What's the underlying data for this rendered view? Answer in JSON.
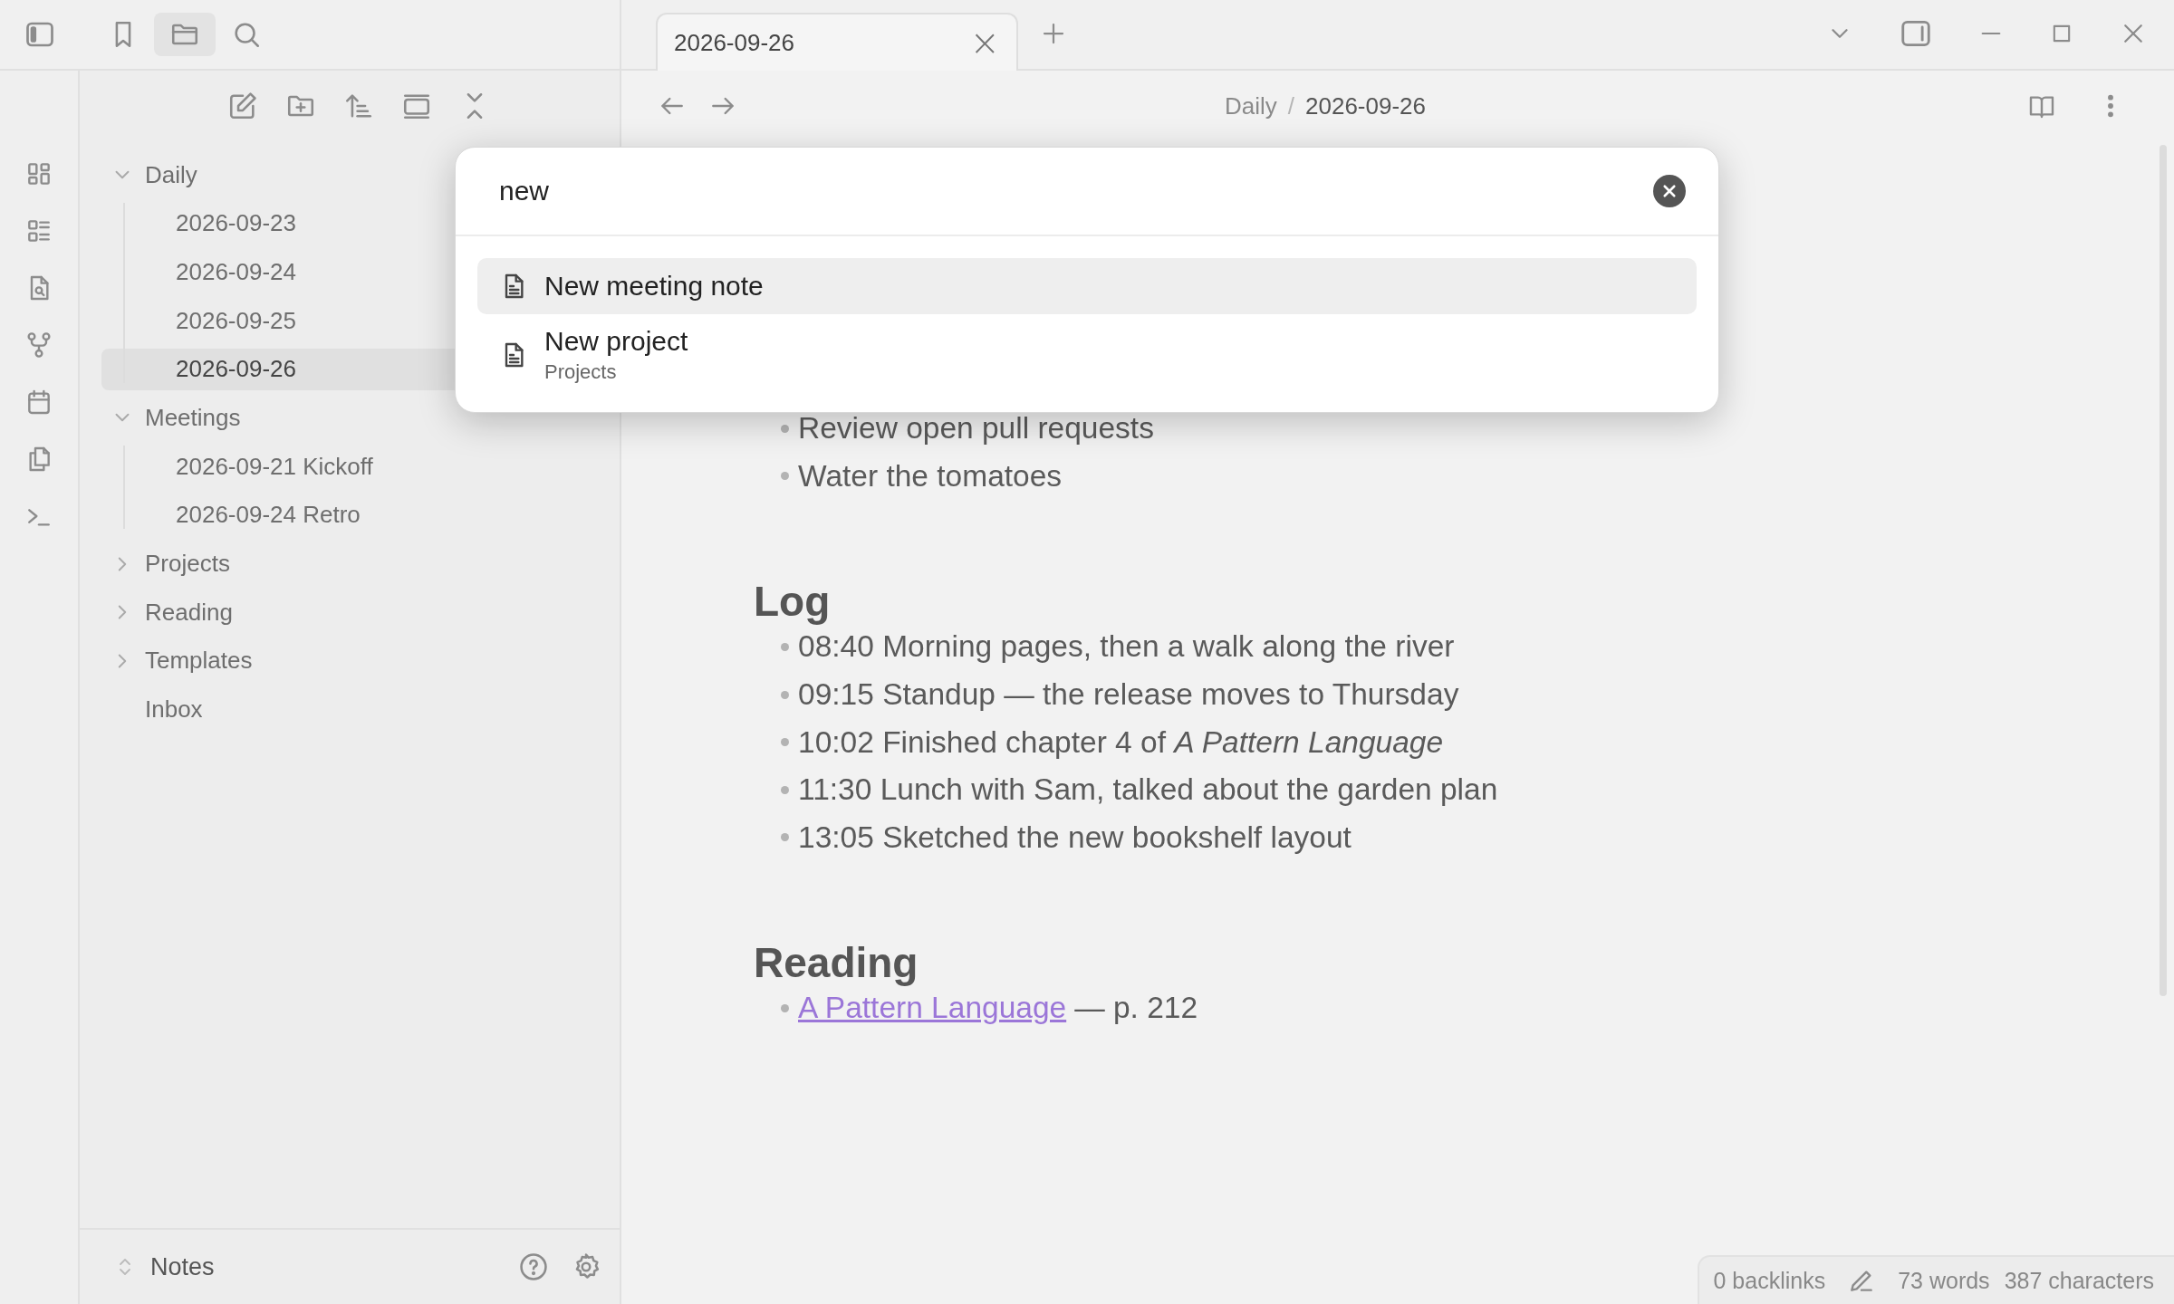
{
  "sidebar_tabs": [
    {
      "kind": "bookmark",
      "selected": false
    },
    {
      "kind": "folder",
      "selected": true
    },
    {
      "kind": "search",
      "selected": false
    }
  ],
  "tab": {
    "title": "2026-09-26",
    "close": "×"
  },
  "breadcrumb": {
    "folder": "Daily",
    "separator": "/",
    "note": "2026-09-26"
  },
  "tree": [
    {
      "kind": "folder",
      "name": "Daily",
      "expanded": true,
      "selected": false,
      "children": [
        {
          "kind": "file",
          "name": "2026-09-23",
          "selected": false
        },
        {
          "kind": "file",
          "name": "2026-09-24",
          "selected": false
        },
        {
          "kind": "file",
          "name": "2026-09-25",
          "selected": false
        },
        {
          "kind": "file",
          "name": "2026-09-26",
          "selected": true
        }
      ]
    },
    {
      "kind": "folder",
      "name": "Meetings",
      "expanded": true,
      "selected": false,
      "children": [
        {
          "kind": "file",
          "name": "2026-09-21 Kickoff",
          "selected": false
        },
        {
          "kind": "file",
          "name": "2026-09-24 Retro",
          "selected": false
        }
      ]
    },
    {
      "kind": "folder",
      "name": "Projects",
      "expanded": false,
      "selected": false
    },
    {
      "kind": "folder",
      "name": "Reading",
      "expanded": false,
      "selected": false
    },
    {
      "kind": "folder",
      "name": "Templates",
      "expanded": false,
      "selected": false
    },
    {
      "kind": "file",
      "name": "Inbox",
      "selected": false
    }
  ],
  "vault": {
    "name": "Notes"
  },
  "editor": {
    "blocks": [
      {
        "kind": "bullet",
        "text": "Review open pull requests"
      },
      {
        "kind": "bullet",
        "text": "Water the tomatoes"
      },
      {
        "kind": "heading",
        "text": "Log"
      },
      {
        "kind": "bullet",
        "text": "08:40 Morning pages, then a walk along the river"
      },
      {
        "kind": "bullet",
        "text": "09:15 Standup — the release moves to Thursday"
      },
      {
        "kind": "bullet",
        "text": "10:02 Finished chapter 4 of *A Pattern Language*"
      },
      {
        "kind": "bullet",
        "text": "11:30 Lunch with Sam, talked about the garden plan"
      },
      {
        "kind": "bullet",
        "text": "13:05 Sketched the new bookshelf layout"
      },
      {
        "kind": "heading",
        "text": "Reading"
      },
      {
        "kind": "link",
        "link": "A Pattern Language",
        "text": "— p. 212"
      }
    ]
  },
  "switcher": {
    "query": "new",
    "results": [
      {
        "title": "New meeting note",
        "selected": true
      },
      {
        "title": "New project",
        "path": "Projects",
        "selected": false
      }
    ]
  },
  "status_bar": {
    "backlinks": "0 backlinks",
    "words": "73 words",
    "characters": "387 characters"
  }
}
